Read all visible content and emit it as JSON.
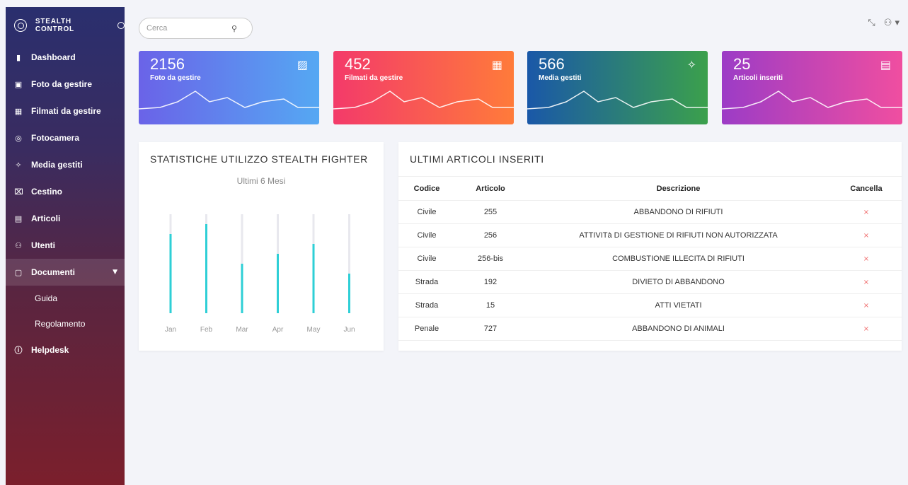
{
  "brand": {
    "name": "STEALTH CONTROL"
  },
  "search": {
    "placeholder": "Cerca"
  },
  "sidebar": {
    "items": [
      {
        "label": "Dashboard",
        "icon": "chart-icon"
      },
      {
        "label": "Foto da gestire",
        "icon": "image-icon"
      },
      {
        "label": "Filmati da gestire",
        "icon": "film-icon"
      },
      {
        "label": "Fotocamera",
        "icon": "camera-icon"
      },
      {
        "label": "Media gestiti",
        "icon": "wand-icon"
      },
      {
        "label": "Cestino",
        "icon": "trash-icon"
      },
      {
        "label": "Articoli",
        "icon": "document-icon"
      },
      {
        "label": "Utenti",
        "icon": "users-icon"
      },
      {
        "label": "Documenti",
        "icon": "folder-icon"
      },
      {
        "label": "Helpdesk",
        "icon": "info-icon"
      }
    ],
    "sub_items": [
      "Guida",
      "Regolamento"
    ]
  },
  "cards": [
    {
      "value": "2156",
      "label": "Foto da gestire",
      "icon": "image-icon"
    },
    {
      "value": "452",
      "label": "Filmati da gestire",
      "icon": "film-icon"
    },
    {
      "value": "566",
      "label": "Media gestiti",
      "icon": "wand-icon"
    },
    {
      "value": "25",
      "label": "Articoli inseriti",
      "icon": "document-icon"
    }
  ],
  "stats_panel": {
    "title": "STATISTICHE UTILIZZO STEALTH FIGHTER",
    "subtitle": "Ultimi 6 Mesi"
  },
  "chart_data": {
    "type": "bar",
    "title": "STATISTICHE UTILIZZO STEALTH FIGHTER",
    "subtitle": "Ultimi 6 Mesi",
    "categories": [
      "Jan",
      "Feb",
      "Mar",
      "Apr",
      "May",
      "Jun"
    ],
    "values": [
      80,
      90,
      50,
      60,
      70,
      40
    ],
    "ylim": [
      0,
      100
    ],
    "colors": {
      "bar": "#2ecfd6",
      "track": "#e8e8ee"
    }
  },
  "articles_panel": {
    "title": "ULTIMI ARTICOLI INSERITI",
    "headers": [
      "Codice",
      "Articolo",
      "Descrizione",
      "Cancella"
    ],
    "rows": [
      {
        "codice": "Civile",
        "articolo": "255",
        "descrizione": "ABBANDONO DI RIFIUTI"
      },
      {
        "codice": "Civile",
        "articolo": "256",
        "descrizione": "ATTIVITà DI GESTIONE DI RIFIUTI NON AUTORIZZATA"
      },
      {
        "codice": "Civile",
        "articolo": "256-bis",
        "descrizione": "COMBUSTIONE ILLECITA DI RIFIUTI"
      },
      {
        "codice": "Strada",
        "articolo": "192",
        "descrizione": "DIVIETO DI ABBANDONO"
      },
      {
        "codice": "Strada",
        "articolo": "15",
        "descrizione": "ATTI VIETATI"
      },
      {
        "codice": "Penale",
        "articolo": "727",
        "descrizione": "ABBANDONO DI ANIMALI"
      }
    ],
    "delete_glyph": "×"
  }
}
